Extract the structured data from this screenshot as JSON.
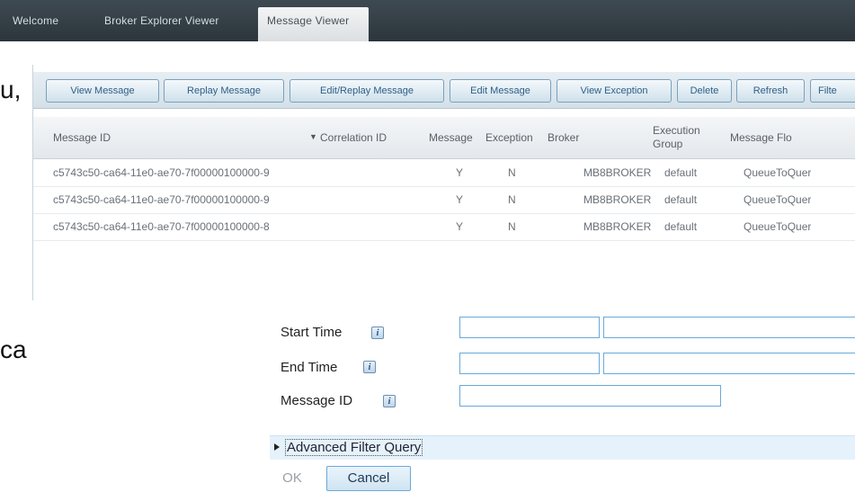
{
  "tabs": [
    {
      "label": "Welcome"
    },
    {
      "label": "Broker Explorer Viewer"
    },
    {
      "label": "Message Viewer"
    }
  ],
  "background_fragments": [
    "u,",
    "ca"
  ],
  "toolbar": {
    "buttons": [
      {
        "label": "View Message"
      },
      {
        "label": "Replay Message"
      },
      {
        "label": "Edit/Replay Message"
      },
      {
        "label": "Edit Message"
      },
      {
        "label": "View Exception"
      },
      {
        "label": "Delete"
      },
      {
        "label": "Refresh"
      },
      {
        "label": "Filte"
      }
    ]
  },
  "table": {
    "columns": {
      "message_id": "Message ID",
      "correlation_id": "Correlation ID",
      "message": "Message",
      "exception": "Exception",
      "broker": "Broker",
      "execution_group": "Execution Group",
      "message_flow": "Message Flo"
    },
    "rows": [
      {
        "message_id": "c5743c50-ca64-11e0-ae70-7f00000100000-9",
        "message": "Y",
        "exception": "N",
        "broker": "MB8BROKER",
        "execution_group": "default",
        "message_flow": "QueueToQuer"
      },
      {
        "message_id": "c5743c50-ca64-11e0-ae70-7f00000100000-9",
        "message": "Y",
        "exception": "N",
        "broker": "MB8BROKER",
        "execution_group": "default",
        "message_flow": "QueueToQuer"
      },
      {
        "message_id": "c5743c50-ca64-11e0-ae70-7f00000100000-8",
        "message": "Y",
        "exception": "N",
        "broker": "MB8BROKER",
        "execution_group": "default",
        "message_flow": "QueueToQuer"
      }
    ]
  },
  "filter": {
    "start_time_label": "Start Time",
    "end_time_label": "End Time",
    "message_id_label": "Message ID",
    "info_glyph": "i",
    "advanced_label": "Advanced Filter Query",
    "ok_label": "OK",
    "cancel_label": "Cancel"
  }
}
